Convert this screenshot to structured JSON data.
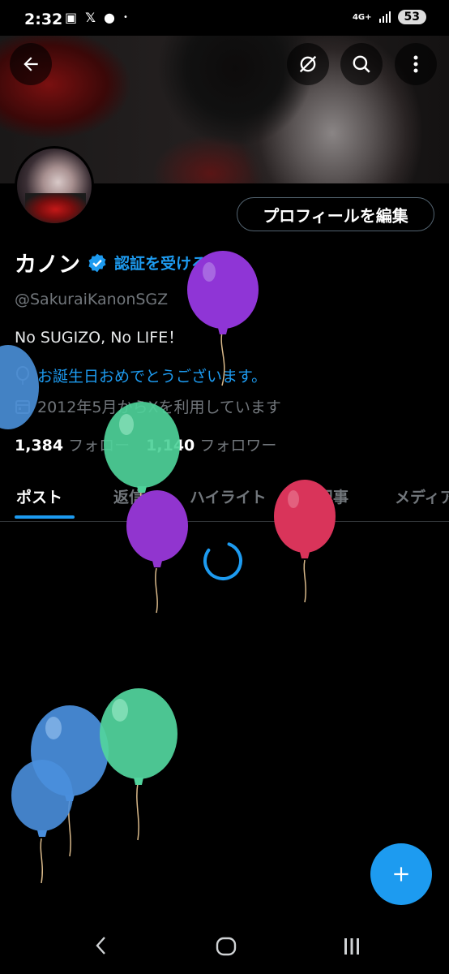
{
  "status_bar": {
    "time": "2:32",
    "network": "4G+",
    "battery": "53"
  },
  "profile": {
    "display_name": "カノン",
    "verify_link": "認証を受ける",
    "handle": "@SakuraiKanonSGZ",
    "bio": "No SUGIZO, No LIFE！",
    "birthday_text": "お誕生日おめでとうございます。",
    "joined_text": "2012年5月からXを利用しています",
    "following_count": "1,384",
    "following_label": "フォロー",
    "followers_count": "1,140",
    "followers_label": "フォロワー",
    "edit_button": "プロフィールを編集"
  },
  "tabs": [
    {
      "label": "ポスト",
      "active": true
    },
    {
      "label": "返信"
    },
    {
      "label": "ハイライト"
    },
    {
      "label": "記事"
    },
    {
      "label": "メディア"
    }
  ],
  "colors": {
    "accent": "#1d9bf0",
    "background": "#000000",
    "muted_text": "#71767b"
  },
  "icons": [
    "back-arrow-icon",
    "no-sync-icon",
    "search-icon",
    "more-vertical-icon",
    "verified-badge-icon",
    "balloon-icon",
    "calendar-icon",
    "plus-icon",
    "nav-back-icon",
    "nav-home-icon",
    "nav-recents-icon"
  ]
}
